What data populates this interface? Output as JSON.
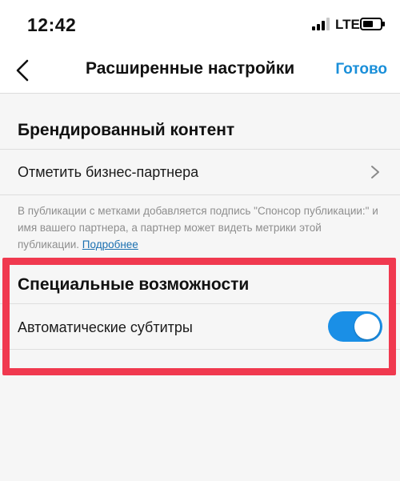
{
  "status_bar": {
    "time": "12:42",
    "network": "LTE",
    "signal_bars_active": 3,
    "signal_bars_total": 4
  },
  "nav": {
    "back_icon": "chevron-left-icon",
    "title": "Расширенные настройки",
    "done_label": "Готово"
  },
  "branded_content": {
    "title": "Брендированный контент",
    "tag_partner_label": "Отметить бизнес-партнера",
    "footnote_text": "В публикации с метками добавляется подпись \"Спонсор публикации:\" и имя вашего партнера, а партнер может видеть метрики этой публикации. ",
    "footnote_link": "Подробнее"
  },
  "accessibility": {
    "title": "Специальные возможности",
    "auto_captions_label": "Автоматические субтитры",
    "auto_captions_enabled": true
  },
  "colors": {
    "accent": "#1a8fd9",
    "toggle_on": "#1a8fe6",
    "highlight": "#f0394f",
    "background": "#f6f6f6"
  }
}
